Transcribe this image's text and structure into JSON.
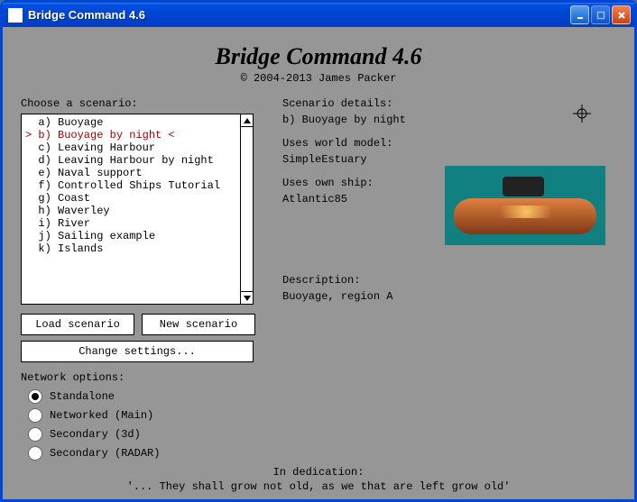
{
  "window": {
    "title": "Bridge Command 4.6"
  },
  "header": {
    "app_title": "Bridge Command 4.6",
    "copyright": "© 2004-2013 James Packer"
  },
  "left_panel": {
    "choose_label": "Choose a scenario:",
    "load_btn": "Load scenario",
    "new_btn": "New scenario",
    "settings_btn": "Change settings...",
    "network_label": "Network options:"
  },
  "scenarios": [
    {
      "key": "a",
      "name": "Buoyage",
      "selected": false
    },
    {
      "key": "b",
      "name": "Buoyage by night",
      "selected": true
    },
    {
      "key": "c",
      "name": "Leaving Harbour",
      "selected": false
    },
    {
      "key": "d",
      "name": "Leaving Harbour by night",
      "selected": false
    },
    {
      "key": "e",
      "name": "Naval support",
      "selected": false
    },
    {
      "key": "f",
      "name": "Controlled Ships Tutorial",
      "selected": false
    },
    {
      "key": "g",
      "name": "Coast",
      "selected": false
    },
    {
      "key": "h",
      "name": "Waverley",
      "selected": false
    },
    {
      "key": "i",
      "name": "River",
      "selected": false
    },
    {
      "key": "j",
      "name": "Sailing example",
      "selected": false
    },
    {
      "key": "k",
      "name": "Islands",
      "selected": false
    }
  ],
  "network_options": [
    {
      "label": "Standalone",
      "checked": true
    },
    {
      "label": "Networked (Main)",
      "checked": false
    },
    {
      "label": "Secondary (3d)",
      "checked": false
    },
    {
      "label": "Secondary (RADAR)",
      "checked": false
    }
  ],
  "details": {
    "heading": "Scenario details:",
    "name_line": "b) Buoyage by night",
    "world_label": "Uses world model:",
    "world_value": "SimpleEstuary",
    "ship_label": "Uses own ship:",
    "ship_value": "Atlantic85",
    "desc_label": "Description:",
    "desc_value": "Buoyage, region A"
  },
  "dedication": {
    "title": "In dedication:",
    "quote": "'... They shall grow not old, as we that are left grow old'"
  }
}
